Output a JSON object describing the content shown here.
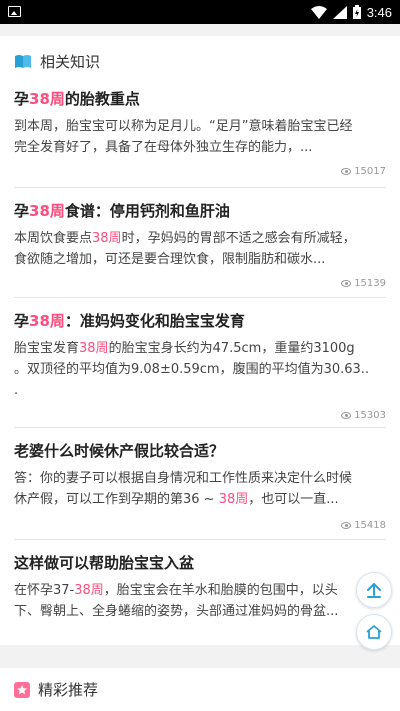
{
  "status_bar": {
    "time": "3:46"
  },
  "knowledge_section": {
    "title": "相关知识",
    "icon": "book-icon"
  },
  "articles": [
    {
      "title_parts": [
        "孕",
        "38周",
        "的胎教重点"
      ],
      "body_lines": [
        "到本周，胎宝宝可以称为足月儿。“足月”意味着胎宝宝已经",
        "完全发育好了，具备了在母体外独立生存的能力，..."
      ],
      "views": "15017"
    },
    {
      "title_parts": [
        "孕",
        "38周",
        "食谱：停用钙剂和鱼肝油"
      ],
      "body_lines": [
        "本周饮食要点38周时，孕妈妈的胃部不适之感会有所减轻，",
        "食欲随之增加，可还是要合理饮食，限制脂肪和碳水..."
      ],
      "views": "15139"
    },
    {
      "title_parts": [
        "孕",
        "38周",
        "：准妈妈变化和胎宝宝发育"
      ],
      "body_lines": [
        "胎宝宝发育38周的胎宝宝身长约为47.5cm，重量约3100g",
        "。双顶径的平均值为9.08±0.59cm，腹围的平均值为30.63..",
        "."
      ],
      "views": "15303"
    },
    {
      "title_parts": [
        "老婆什么时候休产假比较合适？"
      ],
      "body_lines": [
        "答：你的妻子可以根据自身情况和工作性质来决定什么时候",
        "休产假，可以工作到孕期的第36 ~ 38周，也可以一直..."
      ],
      "views": "15418"
    },
    {
      "title_parts": [
        "这样做可以帮助胎宝宝入盆"
      ],
      "body_lines": [
        "在怀孕37-38周，胎宝宝会在羊水和胎膜的包围中，以头",
        "下、臀朝上、全身蜷缩的姿势，头部通过准妈妈的骨盆..."
      ],
      "views": ""
    }
  ],
  "recommend_section": {
    "title": "精彩推荐",
    "icon": "star-icon"
  },
  "colors": {
    "accent": "#ff4d7e",
    "float_icon": "#2aa1d6"
  }
}
